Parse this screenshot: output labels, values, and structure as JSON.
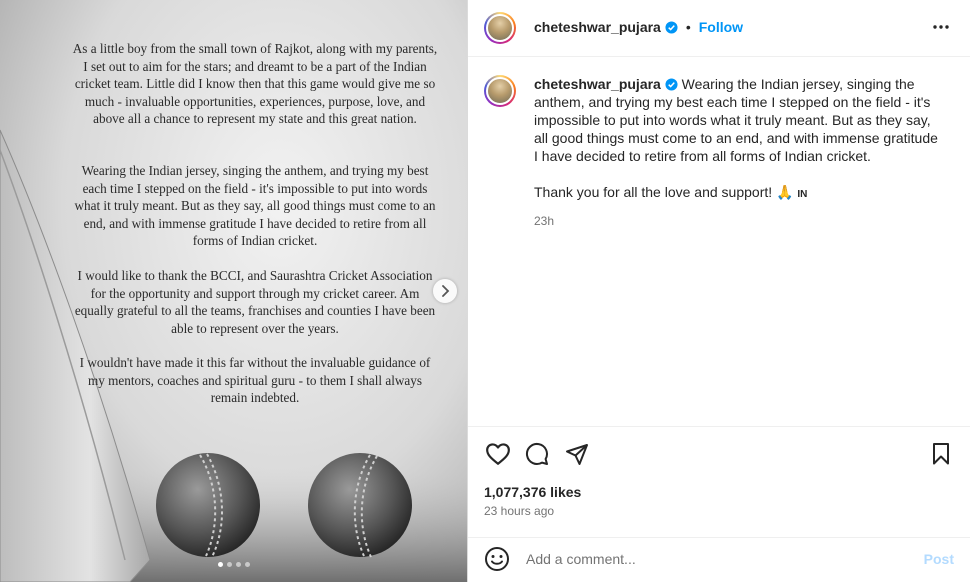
{
  "post_image": {
    "paragraphs": [
      "As a little boy from the small town of Rajkot, along with my parents, I set out to aim for the stars; and dreamt to be a part of the Indian cricket team. Little did I know then that this game would give me so much - invaluable opportunities, experiences, purpose, love, and above all a chance to represent my state and this great nation.",
      "Wearing the Indian jersey, singing the anthem, and trying my best each time I stepped on the field - it's impossible to put into words what it truly meant. But as they say, all good things must come to an end, and with immense gratitude I have decided to retire from all forms of Indian cricket.",
      "I would like to thank the BCCI, and Saurashtra Cricket Association for the opportunity and support through my cricket career. Am equally grateful to all the teams, franchises and counties I have been able to represent over the years.",
      "I wouldn't have made it this far without the invaluable guidance of my mentors, coaches and spiritual guru - to them I shall always remain indebted."
    ],
    "carousel_dots": 4,
    "active_dot": 1
  },
  "header": {
    "username": "cheteshwar_pujara",
    "separator": "•",
    "follow_label": "Follow"
  },
  "caption": {
    "username": "cheteshwar_pujara",
    "text": "Wearing the Indian jersey, singing the anthem, and trying my best each time I stepped on the field - it's impossible to put into words what it truly meant. But as they say, all good things must come to an end, and with immense gratitude I have decided to retire from all forms of Indian cricket.",
    "thanks": "Thank you for all the love and support! 🙏",
    "flag_text": "IN",
    "time": "23h"
  },
  "stats": {
    "likes": "1,077,376 likes",
    "time_ago": "23 hours ago"
  },
  "comment": {
    "placeholder": "Add a comment...",
    "post_label": "Post"
  },
  "colors": {
    "accent": "#0095f6",
    "verified": "#0095f6",
    "post_disabled": "#b3dbff"
  }
}
